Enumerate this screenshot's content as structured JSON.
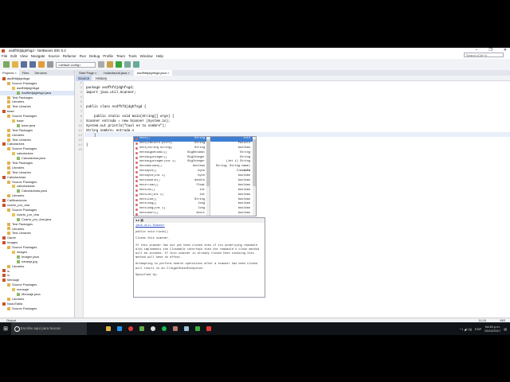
{
  "window": {
    "title": "asdfhfdjdghfsgd - NetBeans IDE 8.2",
    "controls": [
      "–",
      "❐",
      "✕"
    ]
  },
  "menu": [
    "File",
    "Edit",
    "View",
    "Navigate",
    "Source",
    "Refactor",
    "Run",
    "Debug",
    "Profile",
    "Team",
    "Tools",
    "Window",
    "Help"
  ],
  "search": {
    "placeholder": "Search (Ctrl+I)"
  },
  "toolbar": {
    "config": "<default config>"
  },
  "panel_tabs": [
    "Projects ×",
    "Files",
    "Services"
  ],
  "tree": [
    {
      "l": 0,
      "t": "proj",
      "n": "asdfhfdjdghfsgd"
    },
    {
      "l": 1,
      "t": "fold",
      "n": "Source Packages"
    },
    {
      "l": 2,
      "t": "pkg",
      "n": "asdfhfdjdghfsgd"
    },
    {
      "l": 3,
      "t": "java",
      "n": "Asdfhfdjdghfsgd.java",
      "sel": true
    },
    {
      "l": 1,
      "t": "fold",
      "n": "Test Packages"
    },
    {
      "l": 1,
      "t": "fold",
      "n": "Libraries"
    },
    {
      "l": 1,
      "t": "fold",
      "n": "Test Libraries"
    },
    {
      "l": 0,
      "t": "proj",
      "n": "base"
    },
    {
      "l": 1,
      "t": "fold",
      "n": "Source Packages"
    },
    {
      "l": 2,
      "t": "pkg",
      "n": "base"
    },
    {
      "l": 3,
      "t": "java",
      "n": "base.java"
    },
    {
      "l": 1,
      "t": "fold",
      "n": "Test Packages"
    },
    {
      "l": 1,
      "t": "fold",
      "n": "Libraries"
    },
    {
      "l": 1,
      "t": "fold",
      "n": "Test Libraries"
    },
    {
      "l": 0,
      "t": "proj",
      "n": "Calculadora"
    },
    {
      "l": 1,
      "t": "fold",
      "n": "Source Packages"
    },
    {
      "l": 2,
      "t": "pkg",
      "n": "calculadora"
    },
    {
      "l": 3,
      "t": "java",
      "n": "Calculadora.java"
    },
    {
      "l": 1,
      "t": "fold",
      "n": "Test Packages"
    },
    {
      "l": 1,
      "t": "fold",
      "n": "Libraries"
    },
    {
      "l": 1,
      "t": "fold",
      "n": "Test Libraries"
    },
    {
      "l": 0,
      "t": "proj",
      "n": "Calculadoras"
    },
    {
      "l": 1,
      "t": "fold",
      "n": "Source Packages"
    },
    {
      "l": 2,
      "t": "pkg",
      "n": "calculadoras"
    },
    {
      "l": 3,
      "t": "java",
      "n": "Calculadoras.java"
    },
    {
      "l": 1,
      "t": "fold",
      "n": "Libraries"
    },
    {
      "l": 0,
      "t": "proj",
      "n": "Calificaciones"
    },
    {
      "l": 0,
      "t": "proj",
      "n": "cuarto_por_dna"
    },
    {
      "l": 1,
      "t": "fold",
      "n": "Source Packages"
    },
    {
      "l": 2,
      "t": "pkg",
      "n": "cuarto_por_dna"
    },
    {
      "l": 3,
      "t": "java",
      "n": "Cuarto_por_dna.java"
    },
    {
      "l": 1,
      "t": "fold",
      "n": "Test Packages"
    },
    {
      "l": 1,
      "t": "fold",
      "n": "Libraries"
    },
    {
      "l": 1,
      "t": "fold",
      "n": "Test Libraries"
    },
    {
      "l": 0,
      "t": "proj",
      "n": "Game"
    },
    {
      "l": 0,
      "t": "proj",
      "n": "Imagen"
    },
    {
      "l": 1,
      "t": "fold",
      "n": "Source Packages"
    },
    {
      "l": 2,
      "t": "pkg",
      "n": "imagen"
    },
    {
      "l": 3,
      "t": "java",
      "n": "Imagen.java"
    },
    {
      "l": 3,
      "t": "java",
      "n": "naranja.jpg"
    },
    {
      "l": 1,
      "t": "fold",
      "n": "Libraries"
    },
    {
      "l": 0,
      "t": "proj",
      "n": "io"
    },
    {
      "l": 0,
      "t": "proj",
      "n": "io"
    },
    {
      "l": 0,
      "t": "proj",
      "n": "Mensaje"
    },
    {
      "l": 1,
      "t": "fold",
      "n": "Source Packages"
    },
    {
      "l": 2,
      "t": "pkg",
      "n": "mensaje"
    },
    {
      "l": 3,
      "t": "java",
      "n": "Mensaje.java"
    },
    {
      "l": 1,
      "t": "fold",
      "n": "Libraries"
    },
    {
      "l": 0,
      "t": "proj",
      "n": "NodoTabla"
    },
    {
      "l": 1,
      "t": "fold",
      "n": "Source Packages"
    }
  ],
  "editor": {
    "tabs": [
      "Start Page ×",
      "holacdavdd.java ×",
      "Asdfhfdjdghfsgd.java ×"
    ],
    "source_tabs": [
      "Source",
      "History"
    ],
    "line_numbers": [
      "1",
      "2",
      "3",
      "4",
      "5",
      "6",
      "7",
      "8",
      "9",
      "10",
      "11",
      "12",
      "13",
      "14",
      "15"
    ],
    "lines": [
      {
        "n": 2,
        "t": "package asdfhfdjdghfsgd;"
      },
      {
        "n": 3,
        "t": "import java.util.Scanner;"
      },
      {
        "n": 6,
        "t": "public class Asdfhfdjdghfsgd {"
      },
      {
        "n": 8,
        "t": "    public static void main(String[] args) {"
      },
      {
        "n": 9,
        "t": "Scanner entrada = new Scanner (System.in);"
      },
      {
        "n": 10,
        "t": "System.out.println(\"Cual es tu nombre\");"
      },
      {
        "n": 11,
        "t": "String nombre= entrada.s"
      },
      {
        "n": 12,
        "t": "    }"
      },
      {
        "n": 14,
        "t": "}"
      }
    ]
  },
  "completion": {
    "items": [
      [
        "next()",
        "String"
      ],
      [
        "next(Pattern pttrn)",
        "String"
      ],
      [
        "next(String string)",
        "String"
      ],
      [
        "nextBigDecimal()",
        "BigDecimal"
      ],
      [
        "nextBigInteger()",
        "BigInteger"
      ],
      [
        "nextBigInteger(int i)",
        "BigInteger"
      ],
      [
        "nextBoolean()",
        "boolean"
      ],
      [
        "nextByte()",
        "byte"
      ],
      [
        "nextByte(int i)",
        "byte"
      ],
      [
        "nextDouble()",
        "double"
      ],
      [
        "nextFloat()",
        "float"
      ],
      [
        "nextInt()",
        "int"
      ],
      [
        "nextInt(int i)",
        "int"
      ],
      [
        "nextLine()",
        "String"
      ],
      [
        "nextLong()",
        "long"
      ],
      [
        "nextLong(int i)",
        "long"
      ],
      [
        "nextShort()",
        "short"
      ]
    ],
    "right": [
      "void",
      "Pattern",
      "boolean",
      "String",
      "String",
      "(int i)   String",
      "String; String name) void",
      "Class<?>",
      "boolean",
      "boolean",
      "boolean",
      "boolean",
      "boolean",
      "boolean",
      "boolean",
      "boolean",
      "boolean"
    ]
  },
  "javadoc": {
    "class_link": "java.util.Scanner",
    "signature": "public void close()",
    "summary": "Closes this scanner.",
    "para1": "If this scanner has not yet been closed then if its underlying readable also implements the Closeable interface then the readable's close method will be invoked. If this scanner is already closed then invoking this method will have no effect.",
    "para2": "Attempting to perform search operations after a scanner has been closed will result in an IllegalStateException.",
    "specified": "Specified by:"
  },
  "status": {
    "output_label": "Output",
    "position": "11:24",
    "mode": "INS"
  },
  "taskbar": {
    "search_placeholder": "Escribe aquí para buscar",
    "time": "04:45 p.m.",
    "date": "03/12/2017",
    "lang": "ESP"
  }
}
